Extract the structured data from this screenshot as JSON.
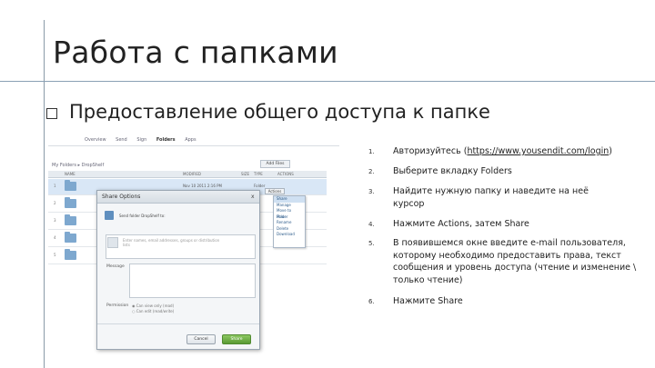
{
  "slide": {
    "title": "Работа с папками",
    "bullet": "Предоставление общего доступа к папке"
  },
  "screenshot": {
    "nav": [
      "Overview",
      "Send",
      "Sign",
      "Folders",
      "Apps"
    ],
    "nav_active_index": 3,
    "breadcrumb": "My Folders ▸ DropShelf",
    "add_button": "Add Files",
    "columns": [
      "NAME",
      "MODIFIED",
      "SIZE",
      "TYPE",
      "ACTIONS"
    ],
    "rows": [
      {
        "num": "1",
        "modified": "Nov 10 2011 2:16 PM",
        "type": "Folder",
        "selected": true
      },
      {
        "num": "2",
        "modified": "",
        "type": "",
        "selected": false
      },
      {
        "num": "3",
        "modified": "",
        "type": "",
        "selected": false
      },
      {
        "num": "4",
        "modified": "",
        "type": "",
        "selected": false
      },
      {
        "num": "5",
        "modified": "",
        "type": "",
        "selected": false
      }
    ],
    "actions_button": "Actions",
    "actions_menu": [
      "Share",
      "Manage",
      "Move to Folder",
      "Move",
      "Rename",
      "Delete",
      "Download"
    ],
    "dialog": {
      "title": "Share Options",
      "close": "x",
      "share_line": "Send folder DropShelf to:",
      "recipient_hint": "Enter names, email addresses, groups or distribution lists",
      "message_label": "Message",
      "permission_label": "Permission",
      "permission_options": [
        "◉ Can view only (read)",
        "○ Can edit (read/write)"
      ],
      "cancel_button": "Cancel",
      "share_button": "Share"
    }
  },
  "steps": [
    {
      "num": "1.",
      "text_before": "Авторизуйтесь (",
      "link": "https://www.yousendit.com/login",
      "text_after": ")"
    },
    {
      "num": "2.",
      "text": "Выберите вкладку Folders"
    },
    {
      "num": "3.",
      "text": "Найдите нужную папку и наведите на неё курсор"
    },
    {
      "num": "4.",
      "text": "Нажмите Actions, затем Share"
    },
    {
      "num": "5.",
      "text": "В появившемся окне введите e-mail пользователя, которому необходимо предоставить права, текст сообщения и уровень доступа (чтение и изменение \\ только чтение)"
    },
    {
      "num": "6.",
      "text": "Нажмите Share"
    }
  ],
  "colors": {
    "title_rule": "#2e5f8a",
    "selected_row": "#d9e7f6",
    "share_button": "#5a9a34"
  }
}
